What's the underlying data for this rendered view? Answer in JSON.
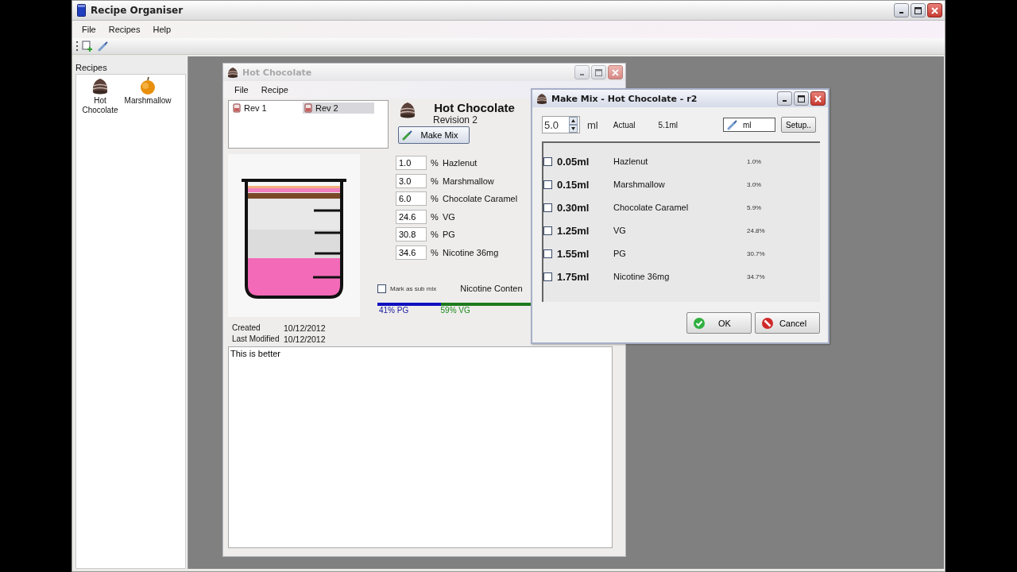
{
  "window": {
    "title": "Recipe Organiser"
  },
  "menu": [
    "File",
    "Recipes",
    "Help"
  ],
  "recipes_panel": {
    "title": "Recipes",
    "items": [
      {
        "label": "Hot Chocolate",
        "kind": "chocolate"
      },
      {
        "label": "Marshmallow",
        "kind": "fruit"
      }
    ]
  },
  "recipe_window": {
    "title": "Hot Chocolate",
    "active": false,
    "menu": [
      "File",
      "Recipe"
    ],
    "revisions": [
      {
        "label": "Rev 1",
        "selected": false
      },
      {
        "label": "Rev 2",
        "selected": true
      }
    ],
    "name": "Hot Chocolate",
    "revision": "Revision 2",
    "make_mix_button": "Make Mix",
    "ingredients": [
      {
        "percent": "1.0",
        "unit": "%",
        "name": "Hazlenut"
      },
      {
        "percent": "3.0",
        "unit": "%",
        "name": "Marshmallow"
      },
      {
        "percent": "6.0",
        "unit": "%",
        "name": "Chocolate Caramel"
      },
      {
        "percent": "24.6",
        "unit": "%",
        "name": "VG"
      },
      {
        "percent": "30.8",
        "unit": "%",
        "name": "PG"
      },
      {
        "percent": "34.6",
        "unit": "%",
        "name": "Nicotine 36mg"
      }
    ],
    "sub_mix": {
      "label": "Mark as sub mix",
      "checked": false
    },
    "nicotine_label": "Nicotine Conten",
    "ratio": {
      "level": 0.41,
      "pg_label": "41% PG",
      "vg_label": "59% VG"
    },
    "created_label": "Created",
    "created": "10/12/2012",
    "modified_label": "Last Modified",
    "modified": "10/12/2012",
    "notes": "This is better"
  },
  "mix_window": {
    "title": "Make Mix - Hot Chocolate - r2",
    "active": true,
    "amount": "5.0",
    "amount_unit": "ml",
    "actual_label": "Actual",
    "actual": "5.1ml",
    "unit_field": "ml",
    "setup_button": "Setup..",
    "items": [
      {
        "checked": false,
        "amount": "0.05ml",
        "name": "Hazlenut",
        "percent": "1.0%"
      },
      {
        "checked": false,
        "amount": "0.15ml",
        "name": "Marshmallow",
        "percent": "3.0%"
      },
      {
        "checked": false,
        "amount": "0.30ml",
        "name": "Chocolate Caramel",
        "percent": "5.9%"
      },
      {
        "checked": false,
        "amount": "1.25ml",
        "name": "VG",
        "percent": "24.8%"
      },
      {
        "checked": false,
        "amount": "1.55ml",
        "name": "PG",
        "percent": "30.7%"
      },
      {
        "checked": false,
        "amount": "1.75ml",
        "name": "Nicotine 36mg",
        "percent": "34.7%"
      }
    ],
    "ok_button": "OK",
    "cancel_button": "Cancel"
  }
}
